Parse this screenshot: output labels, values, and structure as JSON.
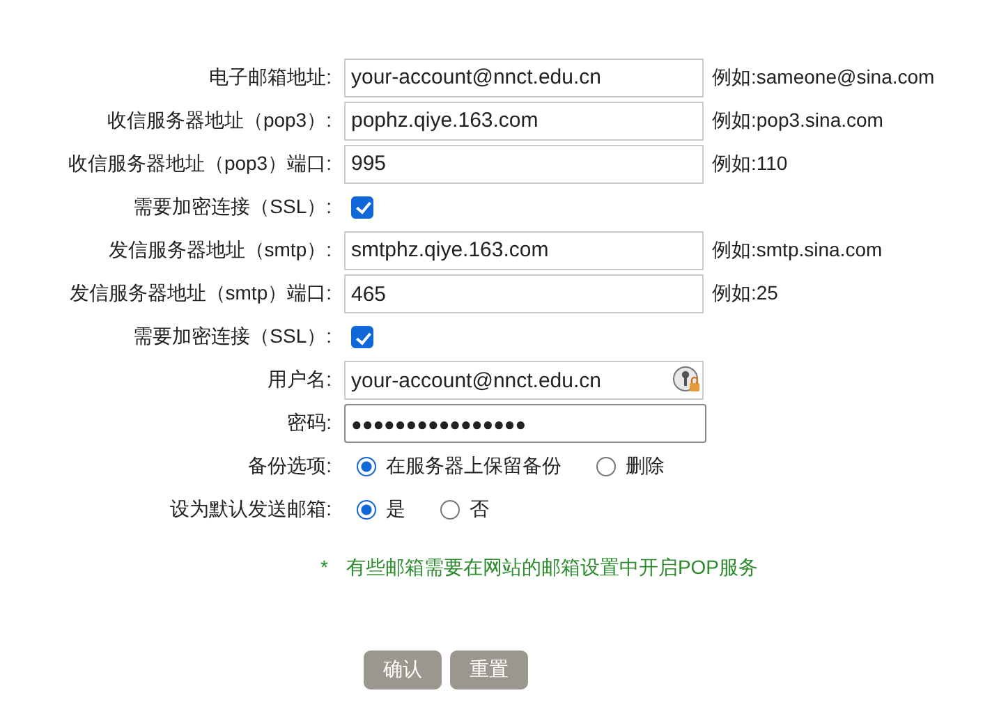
{
  "fields": [
    {
      "kind": "text",
      "label": "电子邮箱地址:",
      "value": "your-account@nnct.edu.cn",
      "hint": "例如:sameone@sina.com"
    },
    {
      "kind": "text",
      "label": "收信服务器地址（pop3）:",
      "value": "pophz.qiye.163.com",
      "hint": "例如:pop3.sina.com"
    },
    {
      "kind": "text",
      "label": "收信服务器地址（pop3）端口:",
      "value": "995",
      "hint": "例如:110"
    },
    {
      "kind": "checkbox",
      "label": "需要加密连接（SSL）:",
      "checked": true
    },
    {
      "kind": "text",
      "label": "发信服务器地址（smtp）:",
      "value": "smtphz.qiye.163.com",
      "hint": "例如:smtp.sina.com"
    },
    {
      "kind": "text",
      "label": "发信服务器地址（smtp）端口:",
      "value": "465",
      "hint": "例如:25"
    },
    {
      "kind": "checkbox",
      "label": "需要加密连接（SSL）:",
      "checked": true
    },
    {
      "kind": "login",
      "label": "用户名:",
      "value": "your-account@nnct.edu.cn"
    },
    {
      "kind": "password",
      "label": "密码:",
      "value": "●●●●●●●●●●●●●●●●"
    },
    {
      "kind": "radio",
      "label": "备份选项:",
      "options": [
        {
          "label": "在服务器上保留备份",
          "selected": true
        },
        {
          "label": "删除",
          "selected": false
        }
      ]
    },
    {
      "kind": "radio",
      "label": "设为默认发送邮箱:",
      "options": [
        {
          "label": "是",
          "selected": true
        },
        {
          "label": "否",
          "selected": false
        }
      ]
    }
  ],
  "note": {
    "mark": "*",
    "text": "有些邮箱需要在网站的邮箱设置中开启POP服务"
  },
  "buttons": [
    "确认",
    "重置"
  ]
}
